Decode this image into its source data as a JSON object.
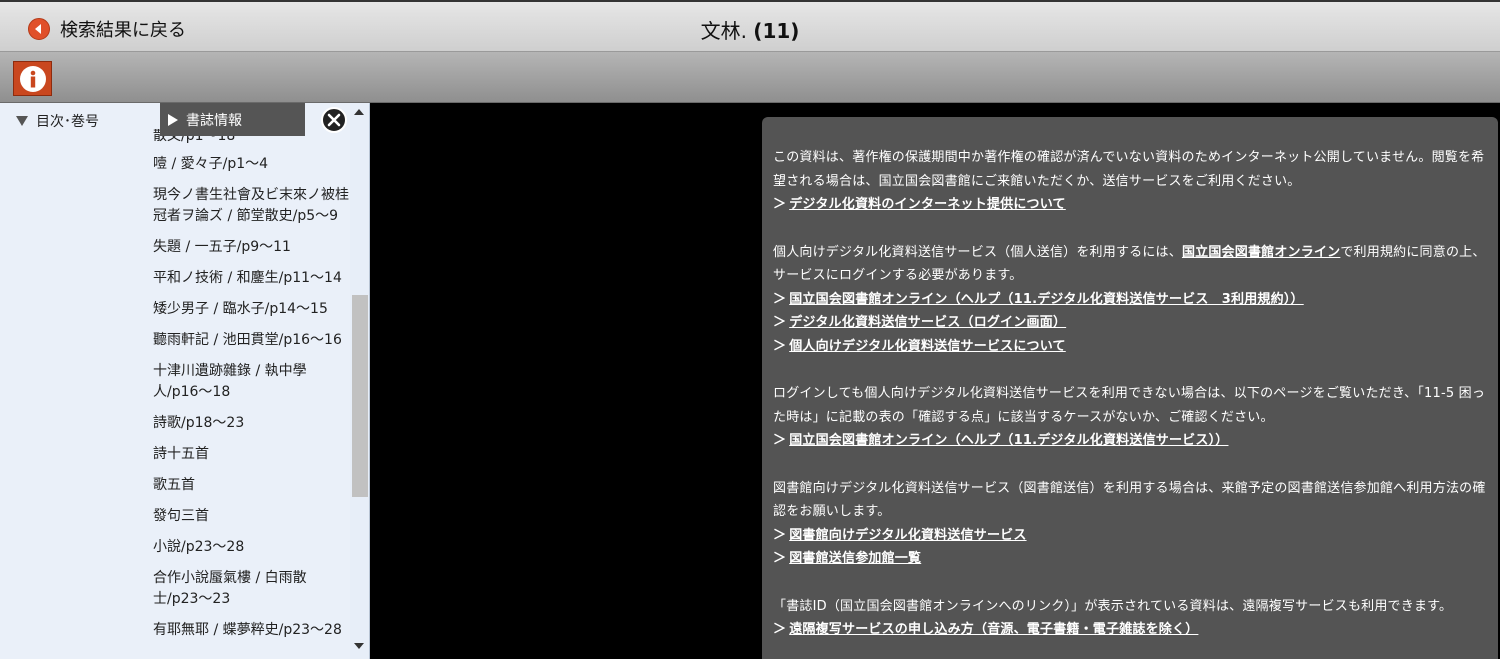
{
  "header": {
    "back_label": "検索結果に戻る",
    "title_name": "文林.",
    "title_volume": "(11)"
  },
  "toc": {
    "heading": "目次･巻号",
    "biblio_tab": "書誌情報",
    "items": [
      "散文/p1〜18",
      "噎 / 愛々子/p1〜4",
      "現今ノ書生社會及ビ末來ノ被桂冠者ヲ論ズ / 節堂散史/p5〜9",
      "失題 / 一五子/p9〜11",
      "平和ノ技術 / 和鏖生/p11〜14",
      "矮少男子 / 臨水子/p14〜15",
      "聽雨軒記 / 池田貫堂/p16〜16",
      "十津川遺跡雜錄 / 執中學人/p16〜18",
      "詩歌/p18〜23",
      "詩十五首",
      "歌五首",
      "發句三首",
      "小說/p23〜28",
      "合作小說蜃氣樓 / 白雨散士/p23〜23",
      "有耶無耶 / 蝶夢粹史/p23〜28"
    ]
  },
  "notice": {
    "p1_text": "この資料は、著作権の保護期間中か著作権の確認が済んでいない資料のためインターネット公開していません。閲覧を希望される場合は、国立国会図書館にご来館いただくか、送信サービスをご利用ください。",
    "p1_link": "デジタル化資料のインターネット提供について",
    "p2_text_a": "個人向けデジタル化資料送信サービス（個人送信）を利用するには、",
    "p2_inline_link": "国立国会図書館オンライン",
    "p2_text_b": "で利用規約に同意の上、サービスにログインする必要があります。",
    "p2_link1": "国立国会図書館オンライン（ヘルプ（11.デジタル化資料送信サービス　3利用規約））",
    "p2_link2": "デジタル化資料送信サービス（ログイン画面）",
    "p2_link3": "個人向けデジタル化資料送信サービスについて",
    "p3_text": "ログインしても個人向けデジタル化資料送信サービスを利用できない場合は、以下のページをご覧いただき、「11-5 困った時は」に記載の表の「確認する点」に該当するケースがないか、ご確認ください。",
    "p3_link": "国立国会図書館オンライン（ヘルプ（11.デジタル化資料送信サービス））",
    "p4_text": "図書館向けデジタル化資料送信サービス（図書館送信）を利用する場合は、来館予定の図書館送信参加館へ利用方法の確認をお願いします。",
    "p4_link1": "図書館向けデジタル化資料送信サービス",
    "p4_link2": "図書館送信参加館一覧",
    "p5_text": "「書誌ID（国立国会図書館オンラインへのリンク）」が表示されている資料は、遠隔複写サービスも利用できます。",
    "p5_link": "遠隔複写サービスの申し込み方（音源、電子書籍・電子雑誌を除く）",
    "link_prefix": "＞"
  },
  "colors": {
    "accent": "#c9471f",
    "sidebar_bg": "#eaf0f9",
    "notice_bg": "#545454"
  }
}
